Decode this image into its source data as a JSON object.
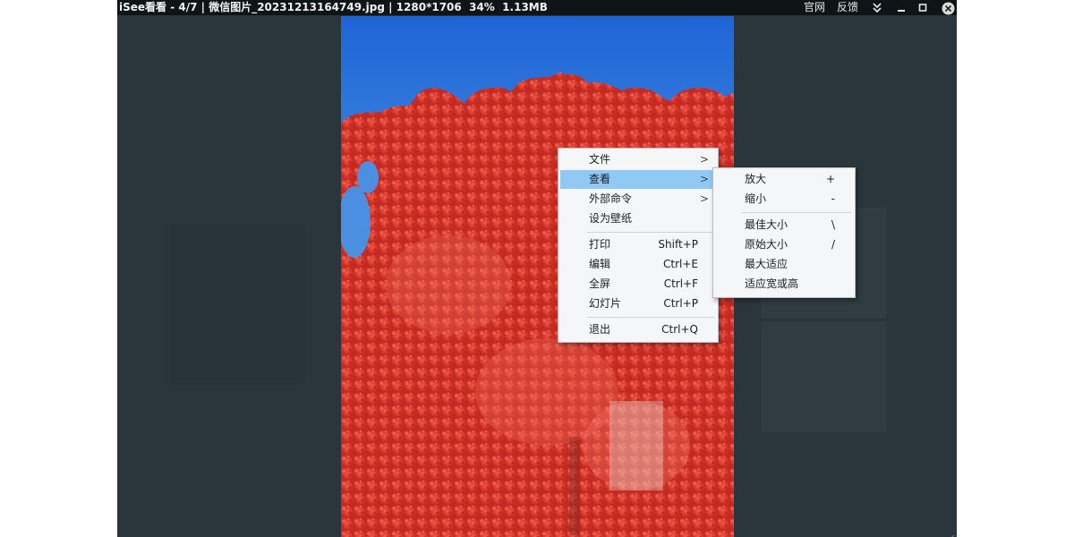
{
  "window": {
    "title": "iSee看看 - 4/7 | 微信图片_20231213164749.jpg | 1280*1706  34%  1.13MB",
    "buttons": {
      "official_site": "官网",
      "feedback": "反馈"
    },
    "icons": [
      "chevron-double-down-icon",
      "minimize-icon",
      "maximize-icon",
      "close-icon"
    ],
    "colors": {
      "titlebar_bg": "#0f1417",
      "backdrop": "#2a353c",
      "menu_highlight": "#90c8f6"
    }
  },
  "image": {
    "description_icon": "red-maple-tree-photo",
    "sky_color": "#2f6fcf",
    "foliage_color": "#d8352a"
  },
  "context_menu": {
    "items": [
      {
        "label": "文件",
        "shortcut": "",
        "has_submenu": true
      },
      {
        "label": "查看",
        "shortcut": "",
        "has_submenu": true,
        "active": true
      },
      {
        "label": "外部命令",
        "shortcut": "",
        "has_submenu": true
      },
      {
        "label": "设为壁纸",
        "shortcut": "",
        "has_submenu": false
      },
      {
        "label": "打印",
        "shortcut": "Shift+P"
      },
      {
        "label": "编辑",
        "shortcut": "Ctrl+E"
      },
      {
        "label": "全屏",
        "shortcut": "Ctrl+F"
      },
      {
        "label": "幻灯片",
        "shortcut": "Ctrl+P"
      },
      {
        "label": "退出",
        "shortcut": "Ctrl+Q"
      }
    ],
    "arrow": ">"
  },
  "view_submenu": {
    "items": [
      {
        "label": "放大",
        "shortcut": "+"
      },
      {
        "label": "缩小",
        "shortcut": "-"
      },
      {
        "label": "最佳大小",
        "shortcut": "\\"
      },
      {
        "label": "原始大小",
        "shortcut": "/"
      },
      {
        "label": "最大适应",
        "shortcut": ""
      },
      {
        "label": "适应宽或高",
        "shortcut": ""
      }
    ]
  }
}
